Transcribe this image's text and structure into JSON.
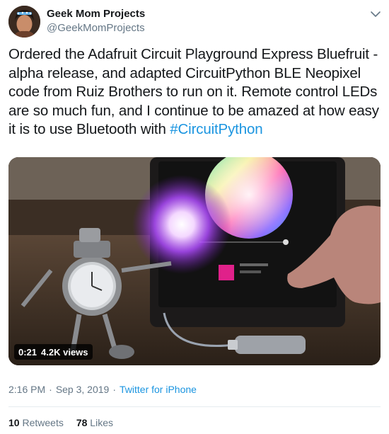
{
  "author": {
    "display_name": "Geek Mom Projects",
    "handle": "@GeekMomProjects",
    "avatar_icon": "profile-avatar"
  },
  "tweet": {
    "text": "Ordered the Adafruit Circuit Playground Express Bluefruit - alpha release, and adapted CircuitPython BLE Neopixel code from Ruiz Brothers to run on it. Remote control LEDs are so much fun, and I continue to be amazed at how easy it is to use Bluetooth with ",
    "hashtag": "#CircuitPython"
  },
  "media": {
    "duration": "0:21",
    "views": "4.2K views"
  },
  "meta": {
    "time": "2:16 PM",
    "separator": "·",
    "date": "Sep 3, 2019",
    "source": "Twitter for iPhone"
  },
  "stats": {
    "retweets_count": "10",
    "retweets_label": "Retweets",
    "likes_count": "78",
    "likes_label": "Likes"
  },
  "colors": {
    "link": "#1b95e0",
    "secondary_text": "#657786",
    "primary_text": "#14171a"
  }
}
